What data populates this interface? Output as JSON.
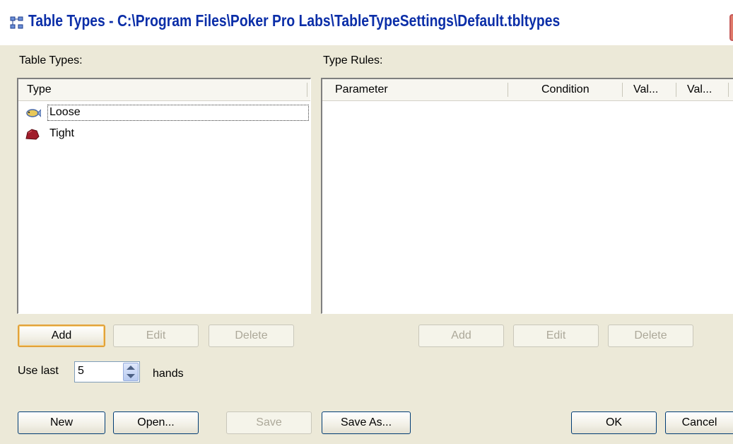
{
  "window": {
    "title": "Table Types - C:\\Program Files\\Poker Pro Labs\\TableTypeSettings\\Default.tbltypes"
  },
  "table_types": {
    "label": "Table Types:",
    "column_header": "Type",
    "items": [
      {
        "label": "Loose",
        "icon": "fish-icon",
        "selected": true
      },
      {
        "label": "Tight",
        "icon": "rock-icon",
        "selected": false
      }
    ],
    "buttons": {
      "add": "Add",
      "edit": "Edit",
      "delete": "Delete"
    }
  },
  "type_rules": {
    "label": "Type Rules:",
    "columns": [
      "Parameter",
      "Condition",
      "Val...",
      "Val..."
    ],
    "rows": [],
    "buttons": {
      "add": "Add",
      "edit": "Edit",
      "delete": "Delete"
    }
  },
  "use_last": {
    "label": "Use last",
    "value": "5",
    "suffix": "hands"
  },
  "footer": {
    "new": "New",
    "open": "Open...",
    "save": "Save",
    "save_as": "Save As...",
    "ok": "OK",
    "cancel": "Cancel"
  },
  "colors": {
    "dialog_bg": "#ece9d8",
    "title_text": "#0b2ea8",
    "default_button_border": "#e2a23a"
  }
}
